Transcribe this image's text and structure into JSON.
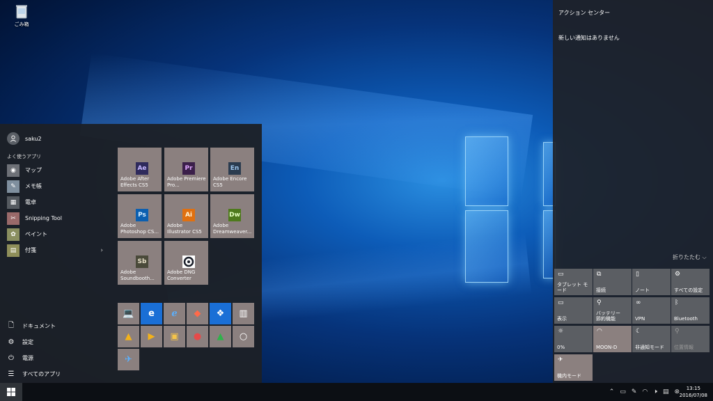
{
  "desktop": {
    "recycle_label": "ごみ箱"
  },
  "start": {
    "user": "saku2",
    "frequent_title": "よく使うアプリ",
    "apps": [
      {
        "label": "マップ",
        "icon": "map-icon"
      },
      {
        "label": "メモ帳",
        "icon": "notepad-icon"
      },
      {
        "label": "電卓",
        "icon": "calculator-icon"
      },
      {
        "label": "Snipping Tool",
        "icon": "scissors-icon"
      },
      {
        "label": "ペイント",
        "icon": "paint-icon"
      },
      {
        "label": "付箋",
        "icon": "sticky-notes-icon"
      }
    ],
    "bottom": [
      {
        "label": "ドキュメント",
        "icon": "document-icon"
      },
      {
        "label": "設定",
        "icon": "gear-icon"
      },
      {
        "label": "電源",
        "icon": "power-icon"
      },
      {
        "label": "すべてのアプリ",
        "icon": "list-icon"
      }
    ],
    "tiles": [
      {
        "abbr": "Ae",
        "label": "Adobe After Effects CS5",
        "color": "#2e2a5c"
      },
      {
        "abbr": "Pr",
        "label": "Adobe Premiere Pro...",
        "color": "#3b1f4a"
      },
      {
        "abbr": "En",
        "label": "Adobe Encore CS5",
        "color": "#2a3b4f"
      },
      {
        "abbr": "Ps",
        "label": "Adobe Photoshop CS...",
        "color": "#0b5fb0"
      },
      {
        "abbr": "Ai",
        "label": "Adobe Illustrator CS5",
        "color": "#e07010"
      },
      {
        "abbr": "Dw",
        "label": "Adobe Dreamweaver...",
        "color": "#4e7a1c"
      },
      {
        "abbr": "Sb",
        "label": "Adobe Soundbooth...",
        "color": "#4a4a3a"
      },
      {
        "abbr": "DNG",
        "label": "Adobe DNG Converter",
        "color": "#ffffff"
      }
    ],
    "small_tiles": [
      {
        "icon": "laptop-icon",
        "bg": "#8b807f"
      },
      {
        "icon": "edge-icon",
        "bg": "#1a6fd6"
      },
      {
        "icon": "ie-icon",
        "bg": "#8b807f"
      },
      {
        "icon": "paint-palette-icon",
        "bg": "#8b807f"
      },
      {
        "icon": "dropbox-icon",
        "bg": "#1a6fd6"
      },
      {
        "icon": "archive-icon",
        "bg": "#8b807f"
      },
      {
        "icon": "aimp-icon",
        "bg": "#8b807f"
      },
      {
        "icon": "media-player-icon",
        "bg": "#8b807f"
      },
      {
        "icon": "picture-icon",
        "bg": "#8b807f"
      },
      {
        "icon": "ladybug-icon",
        "bg": "#8b807f"
      },
      {
        "icon": "google-drive-icon",
        "bg": "#8b807f"
      },
      {
        "icon": "circle-app-icon",
        "bg": "#8b807f"
      },
      {
        "icon": "plane-app-icon",
        "bg": "#8b807f"
      }
    ]
  },
  "action_center": {
    "title": "アクション センター",
    "empty": "新しい通知はありません",
    "collapse": "折りたたむ",
    "quick": [
      {
        "label": "タブレット モード",
        "icon": "tablet-icon",
        "active": false
      },
      {
        "label": "接続",
        "icon": "connect-icon",
        "active": false
      },
      {
        "label": "ノート",
        "icon": "note-icon",
        "active": false
      },
      {
        "label": "すべての設定",
        "icon": "gear-icon",
        "active": false
      },
      {
        "label": "表示",
        "icon": "display-icon",
        "active": false
      },
      {
        "label": "バッテリー\n節約機能",
        "icon": "battery-saver-icon",
        "active": false
      },
      {
        "label": "VPN",
        "icon": "vpn-icon",
        "active": false
      },
      {
        "label": "Bluetooth",
        "icon": "bluetooth-icon",
        "active": false
      },
      {
        "label": "0%",
        "icon": "brightness-icon",
        "active": false
      },
      {
        "label": "MOON-D",
        "icon": "wifi-icon",
        "active": true
      },
      {
        "label": "非通知モード",
        "icon": "moon-icon",
        "active": false
      },
      {
        "label": "位置情報",
        "icon": "location-icon",
        "active": false,
        "dim": true
      },
      {
        "label": "機内モード",
        "icon": "airplane-icon",
        "active": true
      }
    ]
  },
  "taskbar": {
    "time": "13:15",
    "date": "2016/07/08"
  }
}
